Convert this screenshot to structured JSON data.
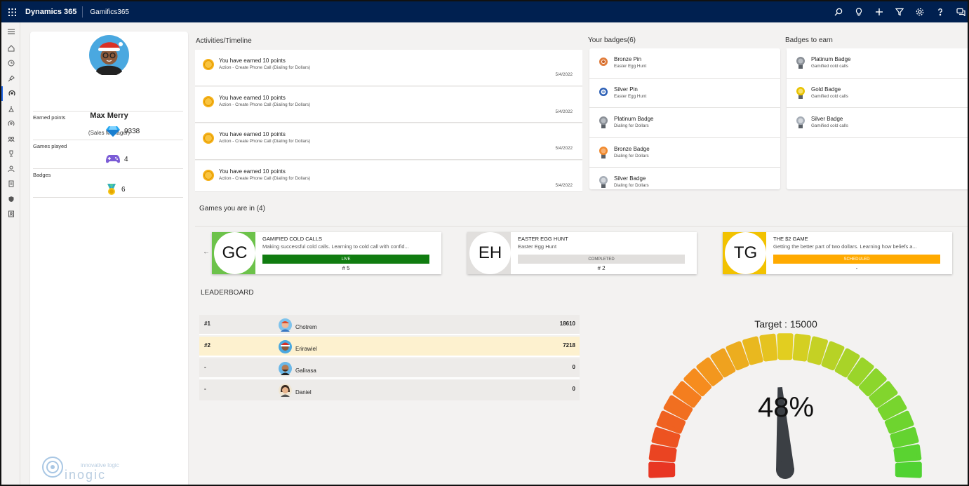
{
  "header": {
    "app_name": "Dynamics 365",
    "module_name": "Gamifics365"
  },
  "profile": {
    "name": "Max Merry",
    "role": "(Sales Manager)",
    "stats": [
      {
        "label": "Earned points",
        "value": "9338",
        "icon": "diamond-icon"
      },
      {
        "label": "Games played",
        "value": "4",
        "icon": "gamepad-icon"
      },
      {
        "label": "Badges",
        "value": "6",
        "icon": "badge-icon"
      }
    ]
  },
  "activities": {
    "title": "Activities/Timeline",
    "items": [
      {
        "title": "You have earned 10 points",
        "sub": "Action - Create Phone Call (Dialing for Dollars)",
        "date": "5/4/2022"
      },
      {
        "title": "You have earned 10 points",
        "sub": "Action - Create Phone Call (Dialing for Dollars)",
        "date": "5/4/2022"
      },
      {
        "title": "You have earned 10 points",
        "sub": "Action - Create Phone Call (Dialing for Dollars)",
        "date": "5/4/2022"
      },
      {
        "title": "You have earned 10 points",
        "sub": "Action - Create Phone Call (Dialing for Dollars)",
        "date": "5/4/2022"
      }
    ]
  },
  "your_badges": {
    "title": "Your badges(6)",
    "items": [
      {
        "name": "Bronze Pin",
        "sub": "Easter Egg Hunt",
        "color": "#e07b3a"
      },
      {
        "name": "Silver Pin",
        "sub": "Easter Egg Hunt",
        "color": "#2b5fb5"
      },
      {
        "name": "Platinum Badge",
        "sub": "Dialing for Dollars",
        "color": "#8a8f96"
      },
      {
        "name": "Bronze Badge",
        "sub": "Dialing for Dollars",
        "color": "#f08a2e"
      },
      {
        "name": "Silver Badge",
        "sub": "Dialing for Dollars",
        "color": "#a6adb6"
      }
    ]
  },
  "badges_to_earn": {
    "title": "Badges to earn",
    "items": [
      {
        "name": "Platinum Badge",
        "sub": "Gamified cold calls",
        "color": "#8a8f96"
      },
      {
        "name": "Gold Badge",
        "sub": "Gamified cold calls",
        "color": "#e8c200"
      },
      {
        "name": "Silver Badge",
        "sub": "Gamified cold calls",
        "color": "#a6adb6"
      }
    ]
  },
  "games": {
    "title": "Games you are in (4)",
    "items": [
      {
        "initials": "GC",
        "name": "GAMIFIED COLD CALLS",
        "desc": "Making successful cold calls. Learning to cold call with confid...",
        "status": "LIVE",
        "rank": "# 5",
        "tile_color": "#6cc24a",
        "status_bg": "#107c10",
        "status_fg": "#ffffff"
      },
      {
        "initials": "EH",
        "name": "EASTER EGG HUNT",
        "desc": "Easter Egg Hunt",
        "status": "COMPLETED",
        "rank": "# 2",
        "tile_color": "#e1dfdd",
        "status_bg": "#e1dfdd",
        "status_fg": "#555555"
      },
      {
        "initials": "TG",
        "name": "THE $2 GAME",
        "desc": "Getting the better part of two dollars. Learning how beliefs a...",
        "status": "SCHEDULED",
        "rank": "-",
        "tile_color": "#f2c200",
        "status_bg": "#ffaa00",
        "status_fg": "#ffffff"
      }
    ]
  },
  "leaderboard": {
    "title": "LEADERBOARD",
    "rows": [
      {
        "rank": "#1",
        "name": "Chotrem",
        "points": "18610"
      },
      {
        "rank": "#2",
        "name": "Erirawiel",
        "points": "7218"
      },
      {
        "rank": "-",
        "name": "Galirasa",
        "points": "0"
      },
      {
        "rank": "-",
        "name": "Daniel",
        "points": "0"
      }
    ]
  },
  "gauge": {
    "target_label": "Target : 15000",
    "percent_label": "48%",
    "fraction": 0.48
  },
  "watermark": {
    "tagline": "innovative logic",
    "brand": "inogic"
  }
}
